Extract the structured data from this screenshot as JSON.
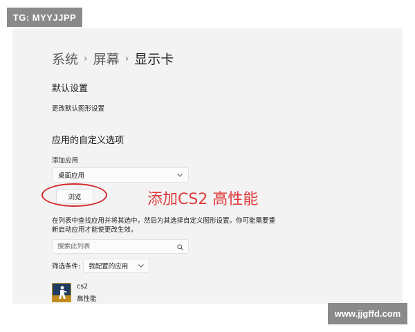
{
  "watermarks": {
    "top": "TG: MYYJJPP",
    "bottom": "www.jjgffd.com"
  },
  "breadcrumb": {
    "items": [
      "系统",
      "屏幕"
    ],
    "current": "显示卡",
    "separator": "›"
  },
  "default_settings": {
    "heading": "默认设置",
    "link": "更改默认图形设置"
  },
  "custom_options": {
    "heading": "应用的自定义选项",
    "add_app_label": "添加应用",
    "app_type_value": "桌面应用",
    "browse_label": "浏览",
    "annotation": "添加CS2 高性能",
    "description": "在列表中查找应用并将其选中，然后为其选择自定义图形设置。你可能需要重新启动应用才能使更改生效。",
    "search_placeholder": "搜索此列表",
    "filter_label": "筛选条件:",
    "filter_value": "我配置的应用"
  },
  "apps": [
    {
      "name": "cs2",
      "performance": "高性能",
      "icon": "cs2-game-icon"
    }
  ],
  "colors": {
    "panel_bg": "#f3f3f3",
    "annotation": "#e03a3a",
    "ellipse": "#d42a2a",
    "watermark_bg": "#8a8a8a"
  }
}
